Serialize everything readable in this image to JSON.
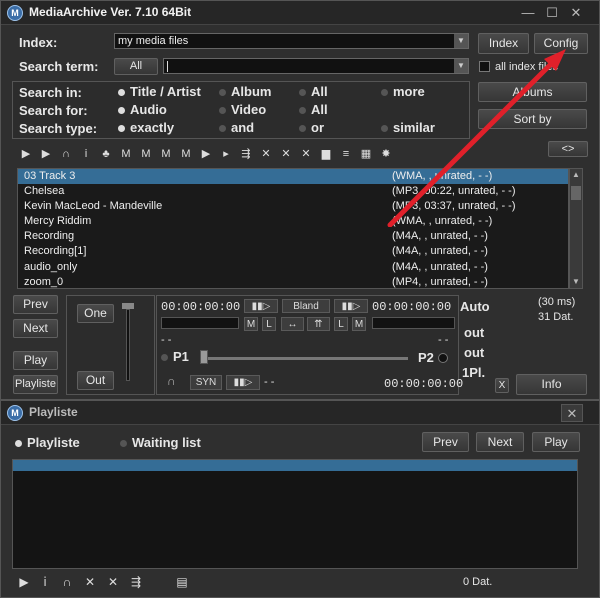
{
  "app": {
    "title": "MediaArchive Ver. 7.10 64Bit",
    "icon_glyph": "M",
    "controls": {
      "min": "—",
      "max": "☐",
      "close": "✕"
    }
  },
  "search": {
    "index_label": "Index:",
    "index_value": "my media files",
    "term_label": "Search term:",
    "all_button": "All",
    "index_button": "Index",
    "config_button": "Config",
    "all_index_label": "all index files",
    "albums_button": "Albums",
    "sortby_button": "Sort by",
    "toggle_button": "<>"
  },
  "options": {
    "in_label": "Search in:",
    "for_label": "Search for:",
    "type_label": "Search type:",
    "in": [
      "Title / Artist",
      "Album",
      "All",
      "more"
    ],
    "for": [
      "Audio",
      "Video",
      "All"
    ],
    "type": [
      "exactly",
      "and",
      "or",
      "similar"
    ]
  },
  "toolbar_icons": [
    "play-icon",
    "play-add-icon",
    "headphone-icon",
    "info-icon",
    "tag-icon",
    "marker-icon",
    "marker-m2-icon",
    "marker-m3-icon",
    "marker-m4-icon",
    "cue-icon",
    "file-arrow-icon",
    "file-move-icon",
    "delete-icon",
    "delete-all-icon",
    "folder-icon",
    "stack-icon",
    "grid-icon",
    "star-icon"
  ],
  "files": [
    {
      "name": "03 Track 3",
      "info": "(WMA, , unrated, - -)",
      "selected": true
    },
    {
      "name": "Chelsea",
      "info": "(MP3, 00:22, unrated, - -)"
    },
    {
      "name": "Kevin MacLeod - Mandeville",
      "info": "(MP3, 03:37, unrated, - -)"
    },
    {
      "name": "Mercy Riddim",
      "info": "(WMA, , unrated, - -)"
    },
    {
      "name": "Recording",
      "info": "(M4A, , unrated, - -)"
    },
    {
      "name": "Recording[1]",
      "info": "(M4A, , unrated, - -)"
    },
    {
      "name": "audio_only",
      "info": "(M4A, , unrated, - -)"
    },
    {
      "name": "zoom_0",
      "info": "(MP4, , unrated, - -)"
    }
  ],
  "player": {
    "prev": "Prev",
    "next": "Next",
    "play": "Play",
    "playlist": "Playliste",
    "one": "One",
    "out": "Out",
    "time1": "00:00:00:00",
    "time2": "00:00:00:00",
    "time3": "00:00:00:00",
    "bland": "Bland",
    "m": "M",
    "l": "L",
    "p1": "P1",
    "p2": "P2",
    "syn": "SYN",
    "dashes": "- -",
    "auto": "Auto",
    "out1": "out",
    "out2": "out",
    "one_pl": "1Pl.",
    "x": "X",
    "info": "Info",
    "ms": "(30 ms)",
    "count": "31 Dat."
  },
  "playlist": {
    "title": "Playliste",
    "tab_playlist": "Playliste",
    "tab_waiting": "Waiting list",
    "prev": "Prev",
    "next": "Next",
    "play": "Play",
    "count": "0 Dat."
  },
  "colors": {
    "accent": "#356d96",
    "arrow": "#e0202a"
  }
}
